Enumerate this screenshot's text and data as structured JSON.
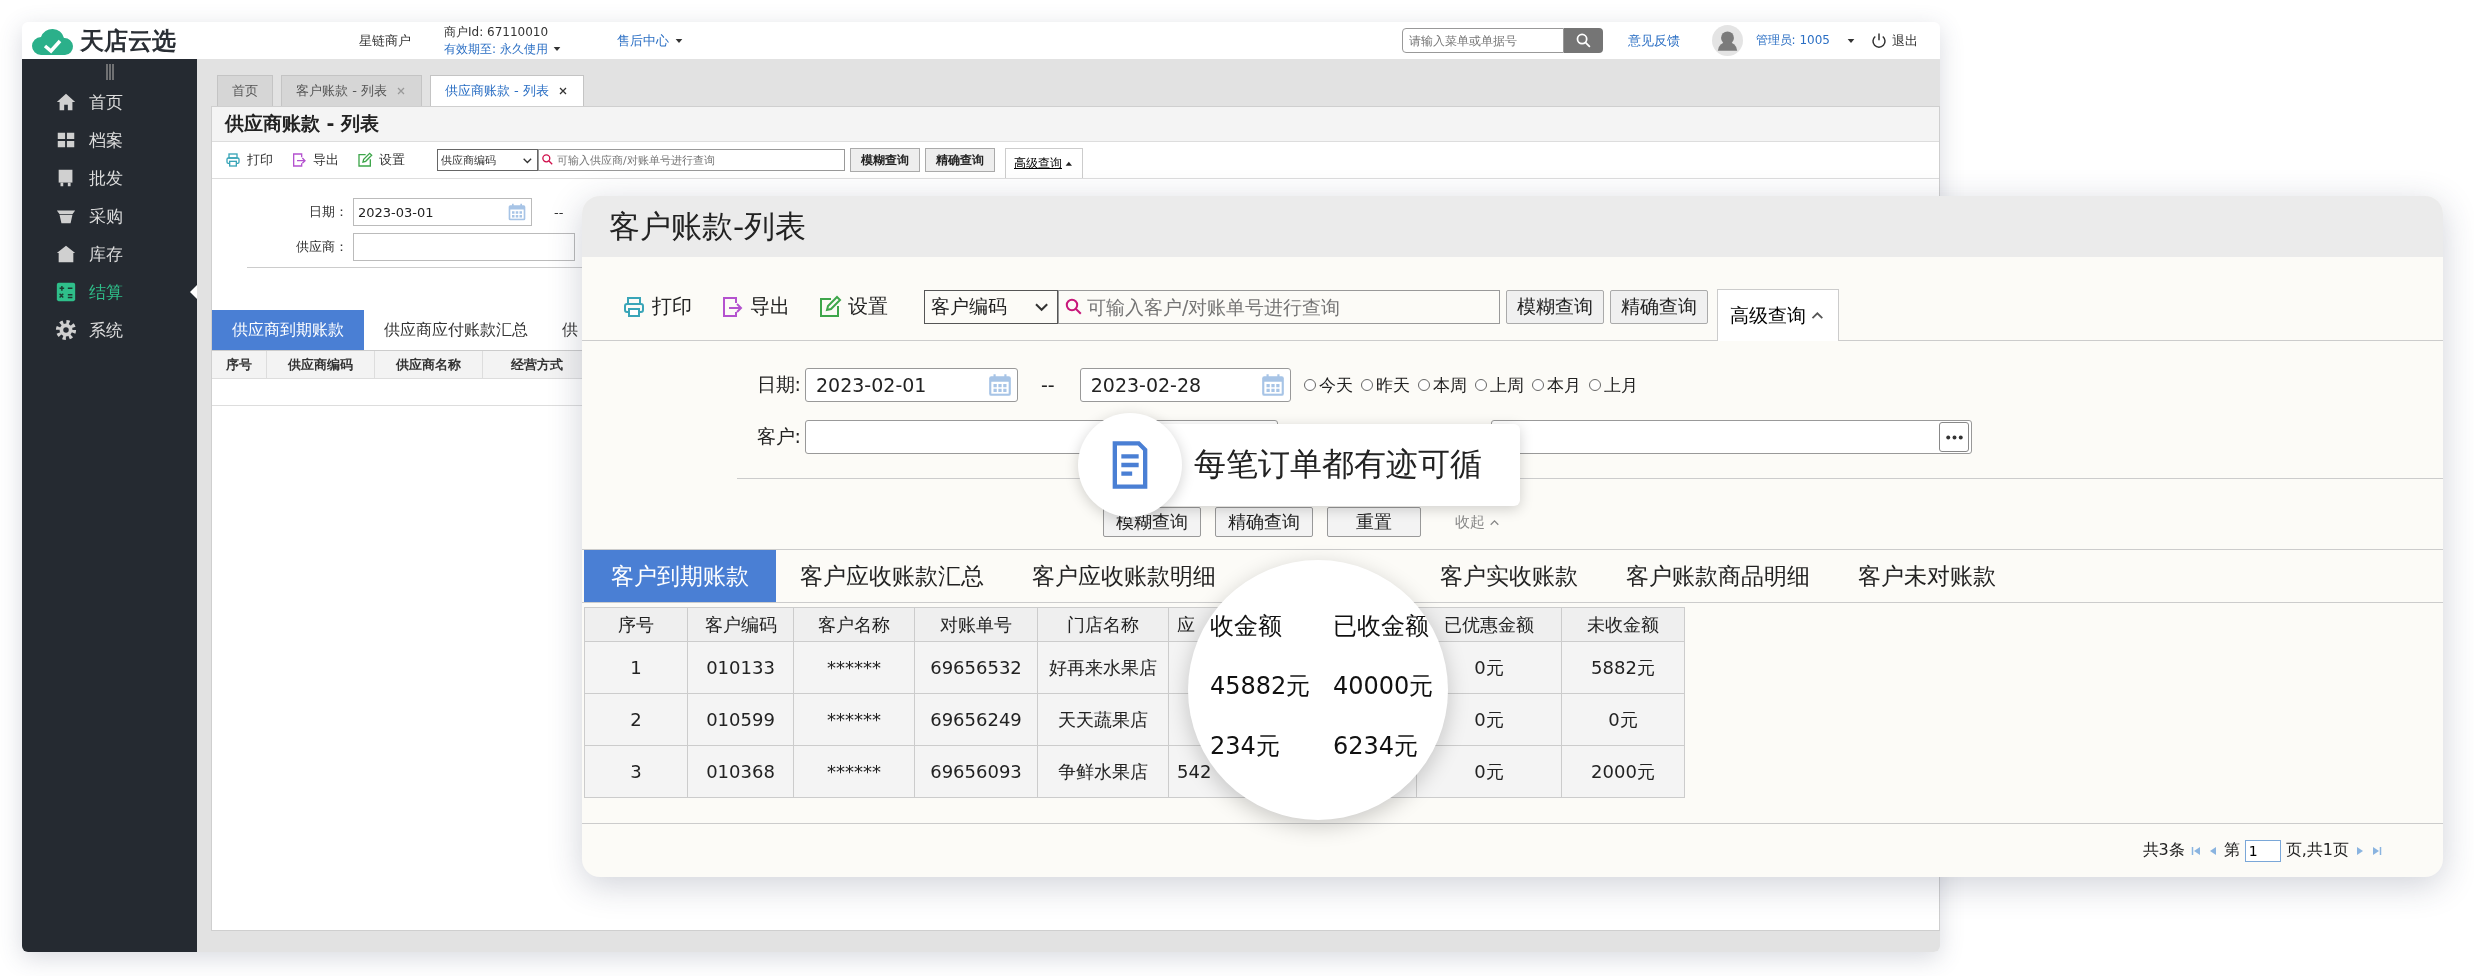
{
  "back_window": {
    "logo": "天店云选",
    "header": {
      "shop": "星链商户",
      "merchant_id": "商户Id: 67110010",
      "validity_label": "有效期至:",
      "validity": "永久使用",
      "after_sales": "售后中心",
      "search_placeholder": "请输入菜单或单据号",
      "feedback": "意见反馈",
      "user": "管理员: 1005",
      "logout": "退出"
    },
    "sidebar": [
      {
        "label": "首页",
        "selected": false
      },
      {
        "label": "档案",
        "selected": false
      },
      {
        "label": "批发",
        "selected": false
      },
      {
        "label": "采购",
        "selected": false
      },
      {
        "label": "库存",
        "selected": false
      },
      {
        "label": "结算",
        "selected": true
      },
      {
        "label": "系统",
        "selected": false
      }
    ],
    "tabs": [
      {
        "label": "首页",
        "closable": false,
        "selected": false
      },
      {
        "label": "客户账款 - 列表",
        "closable": true,
        "selected": false
      },
      {
        "label": "供应商账款 - 列表",
        "closable": true,
        "selected": true
      }
    ],
    "title": "供应商账款 - 列表",
    "toolbar": {
      "actions": [
        {
          "kind": "print",
          "label": "打印"
        },
        {
          "kind": "export",
          "label": "导出"
        },
        {
          "kind": "edit",
          "label": "设置"
        }
      ],
      "select": "供应商编码",
      "search_placeholder": "可输入供应商/对账单号进行查询",
      "buttons": [
        "模糊查询",
        "精确查询"
      ],
      "advanced": {
        "label": "高级查询",
        "expanded": true
      }
    },
    "filters": {
      "date_label": "日期：",
      "date_from": "2023-03-01",
      "separator": "--",
      "supplier_label": "供应商："
    },
    "sub_tabs": [
      {
        "label": "供应商到期账款",
        "selected": true
      },
      {
        "label": "供应商应付账款汇总",
        "selected": false
      },
      {
        "label": "供",
        "selected": false
      }
    ],
    "table_columns": [
      "序号",
      "供应商编码",
      "供应商名称",
      "经营方式"
    ]
  },
  "front_window": {
    "title": "客户账款-列表",
    "toolbar": {
      "actions": [
        {
          "kind": "print",
          "label": "打印"
        },
        {
          "kind": "export",
          "label": "导出"
        },
        {
          "kind": "edit",
          "label": "设置"
        }
      ],
      "select": "客户编码",
      "search_placeholder": "可输入客户/对账单号进行查询",
      "buttons": [
        "模糊查询",
        "精确查询"
      ],
      "advanced": {
        "label": "高级查询",
        "expanded": true
      }
    },
    "filters": {
      "date_label": "日期:",
      "date_from": "2023-02-01",
      "separator": "--",
      "date_to": "2023-02-28",
      "quick_ranges": [
        {
          "label": "今天",
          "selected": false
        },
        {
          "label": "昨天",
          "selected": false
        },
        {
          "label": "本周",
          "selected": false
        },
        {
          "label": "上周",
          "selected": false
        },
        {
          "label": "本月",
          "selected": false
        },
        {
          "label": "上月",
          "selected": false
        }
      ],
      "customer_label": "客户:",
      "buttons": [
        "模糊查询",
        "精确查询",
        "重置"
      ],
      "collapse": {
        "label": "收起",
        "expanded": true
      }
    },
    "tabs": [
      {
        "label": "客户到期账款",
        "selected": true
      },
      {
        "label": "客户应收账款汇总",
        "selected": false
      },
      {
        "label": "客户应收账款明细",
        "selected": false
      },
      {
        "label": "客户实收账款",
        "selected": false
      },
      {
        "label": "客户账款商品明细",
        "selected": false
      },
      {
        "label": "客户未对账款",
        "selected": false
      }
    ],
    "table": {
      "columns": [
        "序号",
        "客户编码",
        "客户名称",
        "对账单号",
        "门店名称",
        "应",
        null,
        "已优惠金额",
        "未收金额"
      ],
      "rows": [
        [
          "1",
          "010133",
          "******",
          "69656532",
          "好再来水果店",
          null,
          null,
          "0元",
          "5882元"
        ],
        [
          "2",
          "010599",
          "******",
          "69656249",
          "天天蔬果店",
          null,
          null,
          "0元",
          "0元"
        ],
        [
          "3",
          "010368",
          "******",
          "69656093",
          "争鲜水果店",
          "542",
          null,
          "0元",
          "2000元"
        ]
      ]
    },
    "pagination": {
      "total": "共3条",
      "page_label": "第",
      "page": "1",
      "page_suffix": "页,共1页"
    }
  },
  "callout": {
    "text": "每笔订单都有迹可循"
  },
  "magnifier": {
    "columns": [
      "收金额",
      "已收金额"
    ],
    "rows": [
      [
        "45882元",
        "40000元"
      ],
      [
        "234元",
        "6234元"
      ]
    ]
  }
}
